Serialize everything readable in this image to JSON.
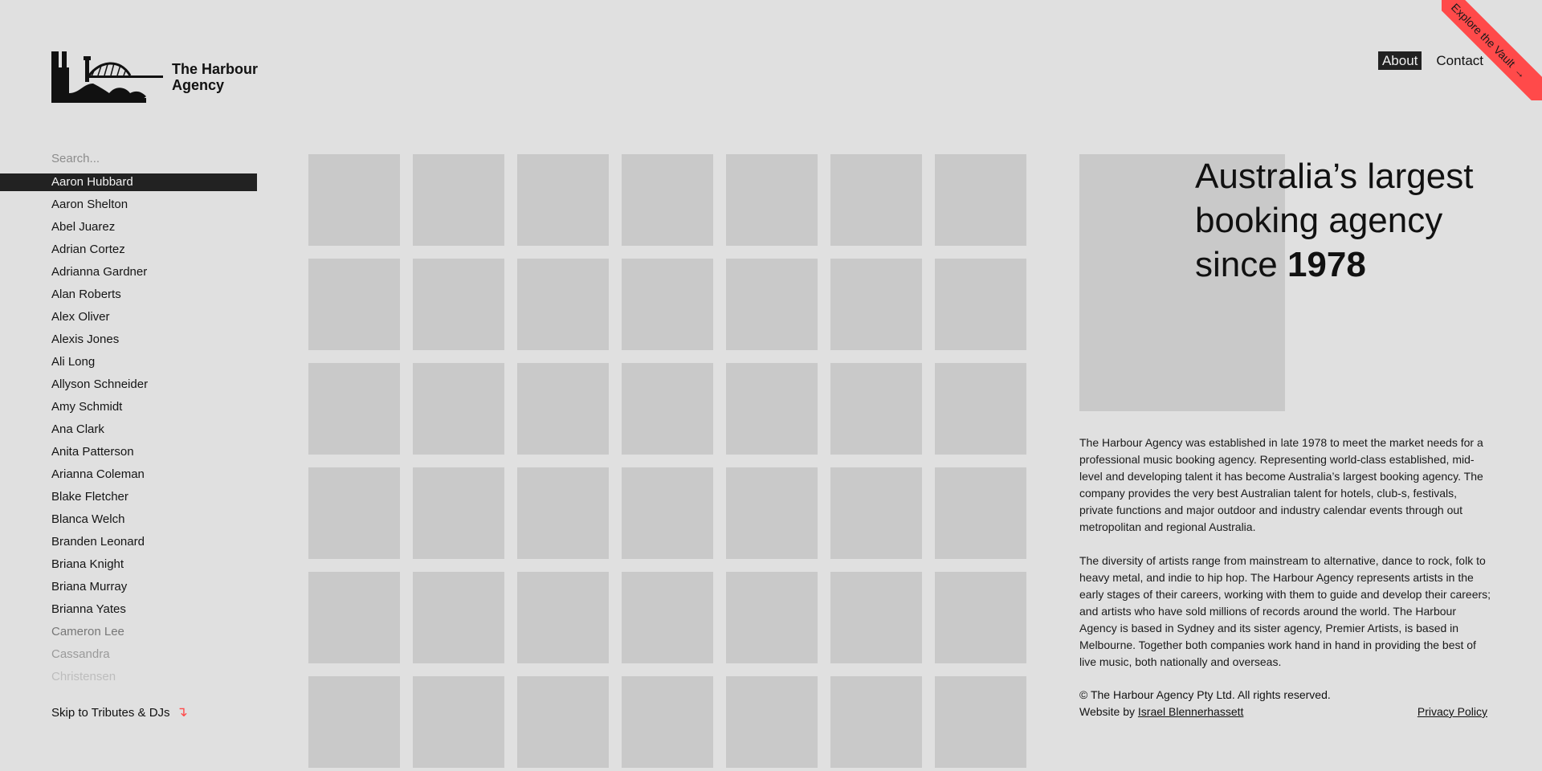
{
  "brand": {
    "line1": "The Harbour",
    "line2": "Agency"
  },
  "nav": [
    {
      "label": "About",
      "active": true
    },
    {
      "label": "Contact",
      "active": false
    }
  ],
  "ribbon": {
    "label": "Explore the Vault",
    "arrow": "→"
  },
  "search": {
    "placeholder": "Search..."
  },
  "artists": [
    {
      "name": "Aaron Hubbard",
      "state": "active"
    },
    {
      "name": "Aaron Shelton"
    },
    {
      "name": "Abel Juarez"
    },
    {
      "name": "Adrian Cortez"
    },
    {
      "name": "Adrianna Gardner"
    },
    {
      "name": "Alan Roberts"
    },
    {
      "name": "Alex Oliver"
    },
    {
      "name": "Alexis Jones"
    },
    {
      "name": "Ali Long"
    },
    {
      "name": "Allyson Schneider"
    },
    {
      "name": "Amy Schmidt"
    },
    {
      "name": "Ana Clark"
    },
    {
      "name": "Anita Patterson"
    },
    {
      "name": "Arianna Coleman"
    },
    {
      "name": "Blake Fletcher"
    },
    {
      "name": "Blanca Welch"
    },
    {
      "name": "Branden Leonard"
    },
    {
      "name": "Briana Knight"
    },
    {
      "name": "Briana Murray"
    },
    {
      "name": "Brianna Yates"
    },
    {
      "name": "Cameron Lee",
      "state": "fade1"
    },
    {
      "name": "Cassandra",
      "state": "fade2"
    },
    {
      "name": "Christensen",
      "state": "fade3"
    }
  ],
  "skip": {
    "label": "Skip to Tributes & DJs",
    "arrow": "↴"
  },
  "grid": {
    "tile_count": 42
  },
  "headline": {
    "text": "Australia’s largest booking agency since ",
    "year": "1978"
  },
  "about": {
    "p1": "The Harbour Agency was established in late 1978 to meet the market needs for a professional music booking agency. Representing world-class established, mid-level and developing talent it has become Australia’s largest booking agency. The company provides the very best Australian talent for hotels, club-s, festivals, private functions and major outdoor and industry calendar events through out metropolitan and regional Australia.",
    "p2": "The diversity of artists range from mainstream to alternative, dance to rock, folk to heavy metal, and indie to hip hop. The Harbour Agency represents artists in the early stages of their careers, working with them to guide and develop their careers; and artists who have sold millions of records around the world. The Harbour Agency is based in Sydney and its sister agency, Premier Artists, is based in Melbourne. Together both companies work hand in hand in providing the best of live music, both nationally and overseas."
  },
  "footer": {
    "copyright": "© The Harbour Agency Pty Ltd. All rights reserved.",
    "credit_prefix": "Website by ",
    "credit_name": "Israel Blennerhassett",
    "privacy": "Privacy Policy"
  },
  "colors": {
    "background": "#e0e0e0",
    "tile": "#c9c9c9",
    "accent": "#ff4a4a",
    "active": "#222222"
  }
}
